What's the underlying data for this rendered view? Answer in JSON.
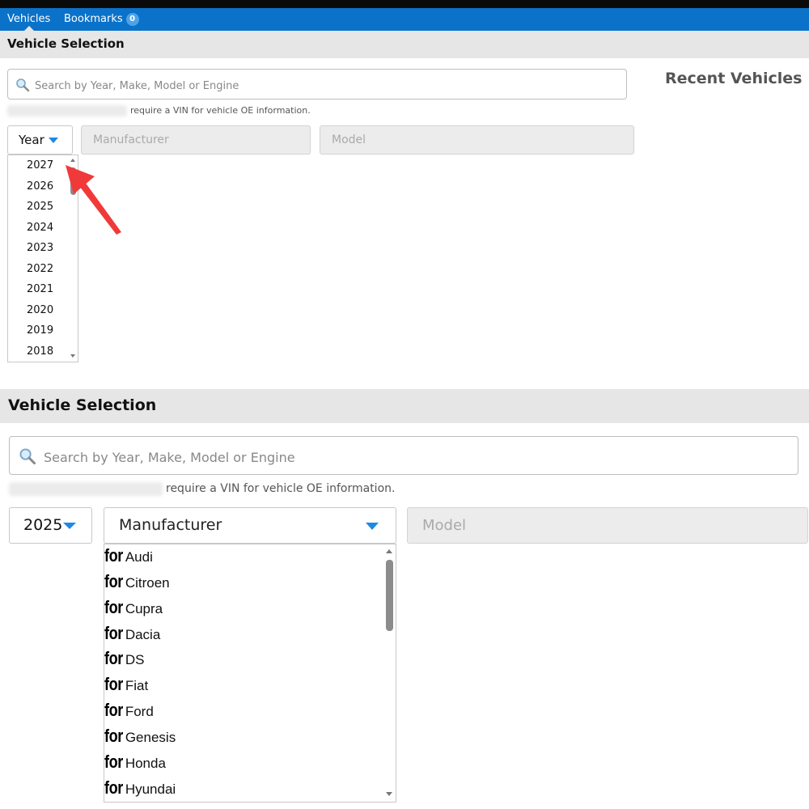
{
  "tabs": [
    {
      "label": "Vehicles",
      "active": true
    },
    {
      "label": "Bookmarks",
      "badge": "0"
    }
  ],
  "panel1": {
    "section_title": "Vehicle Selection",
    "search_placeholder": "Search by Year, Make, Model or Engine",
    "vin_note": "require a VIN for vehicle OE information.",
    "recent_title": "Recent Vehicles",
    "year_select": "Year",
    "manufacturer_select": "Manufacturer",
    "model_select": "Model",
    "years": [
      "2027",
      "2026",
      "2025",
      "2024",
      "2023",
      "2022",
      "2021",
      "2020",
      "2019",
      "2018"
    ]
  },
  "panel2": {
    "section_title": "Vehicle Selection",
    "search_placeholder": "Search by Year, Make, Model or Engine",
    "vin_note": "require a VIN for vehicle OE information.",
    "year_select": "2025",
    "manufacturer_select": "Manufacturer",
    "model_select": "Model",
    "prefix": "for",
    "makes": [
      "Audi",
      "Citroen",
      "Cupra",
      "Dacia",
      "DS",
      "Fiat",
      "Ford",
      "Genesis",
      "Honda",
      "Hyundai"
    ]
  },
  "colors": {
    "tabbar": "#0b72c9",
    "caret": "#1e88e5",
    "arrow": "#f03a3a"
  },
  "icons": {
    "search": "magnifier-icon",
    "caret": "caret-down-icon"
  }
}
